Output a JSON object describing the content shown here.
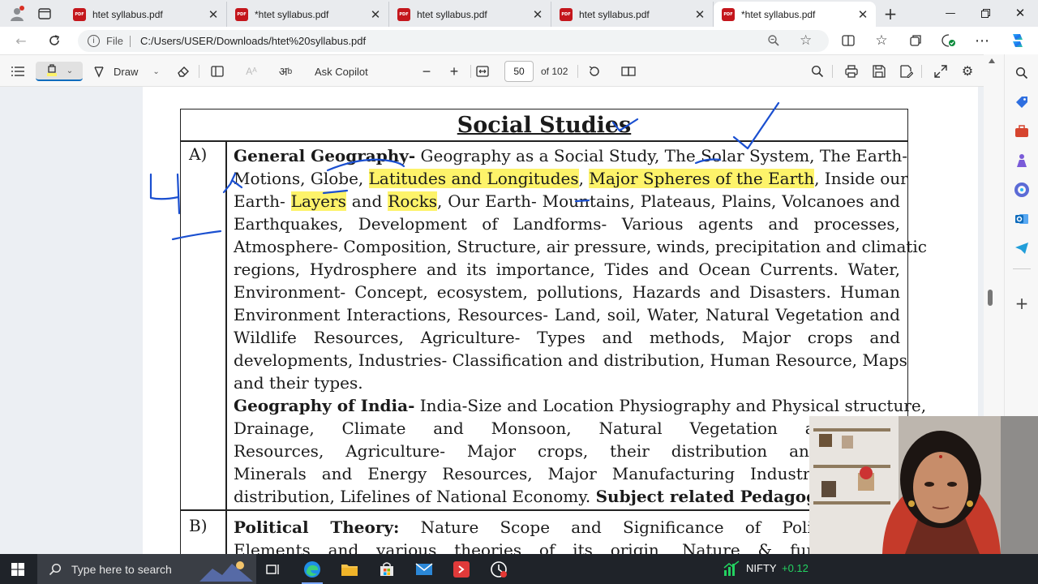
{
  "browser": {
    "tabs": [
      {
        "title": "htet syllabus.pdf",
        "active": false
      },
      {
        "title": "*htet syllabus.pdf",
        "active": false
      },
      {
        "title": "htet syllabus.pdf",
        "active": false
      },
      {
        "title": "htet syllabus.pdf",
        "active": false
      },
      {
        "title": "*htet syllabus.pdf",
        "active": true
      }
    ],
    "pdf_icon_text": "PDF",
    "address": {
      "scheme_label": "File",
      "url": "C:/Users/USER/Downloads/htet%20syllabus.pdf"
    }
  },
  "pdf_toolbar": {
    "draw_label": "Draw",
    "copilot_label": "Ask Copilot",
    "page_number": "50",
    "page_total": "of 102"
  },
  "document": {
    "heading": "Social Studies",
    "section_a_label": "A)",
    "section_b_label": "B)",
    "lines": [
      [
        "General Geography-",
        " Geography as a Social Study, The Solar System, The Earth-"
      ],
      [
        "Motions, Globe, ",
        "Latitudes and Longitudes",
        ", ",
        "Major Spheres of the Earth",
        ", Inside our"
      ],
      [
        "Earth- ",
        "Layers",
        " and ",
        "Rocks",
        ", Our Earth- Mountains, Plateaus, Plains, Volcanoes and"
      ],
      "Earthquakes, Development of Landforms- Various agents and processes,",
      "Atmosphere- Composition, Structure, air pressure, winds, precipitation and climatic",
      "regions, Hydrosphere and its importance, Tides and Ocean Currents. Water,",
      "Environment- Concept, ecosystem, pollutions, Hazards and Disasters. Human",
      "Environment Interactions, Resources- Land, soil, Water, Natural Vegetation and",
      "Wildlife Resources, Agriculture- Types and methods, Major crops and",
      "developments, Industries- Classification and distribution, Human Resource, Maps",
      "and their types.",
      [
        "Geography of India-",
        " India-Size and Location Physiography and Physical structure,"
      ],
      "Drainage, Climate and Monsoon, Natural Vegetation and Wild",
      "Resources, Agriculture- Major crops, their distribution and related",
      "Minerals and Energy Resources, Major Manufacturing Industries- classi",
      [
        "distribution, Lifelines of National Economy. ",
        "Subject related Pedagogy",
        "."
      ],
      [
        "Political Theory:",
        " Nature Scope and Significance of Political The"
      ],
      "Elements and various theories of its origin, Nature & functions, S"
    ],
    "annotation_text": "U"
  },
  "taskbar": {
    "search_placeholder": "Type here to search",
    "ticker_name": "NIFTY",
    "ticker_change": "+0.12",
    "ticker_color": "#23d160"
  },
  "colors": {
    "highlight": "#fdf36a",
    "ink": "#1a4fd0",
    "accent": "#0f6cbd",
    "pdf_red": "#c4161c"
  }
}
